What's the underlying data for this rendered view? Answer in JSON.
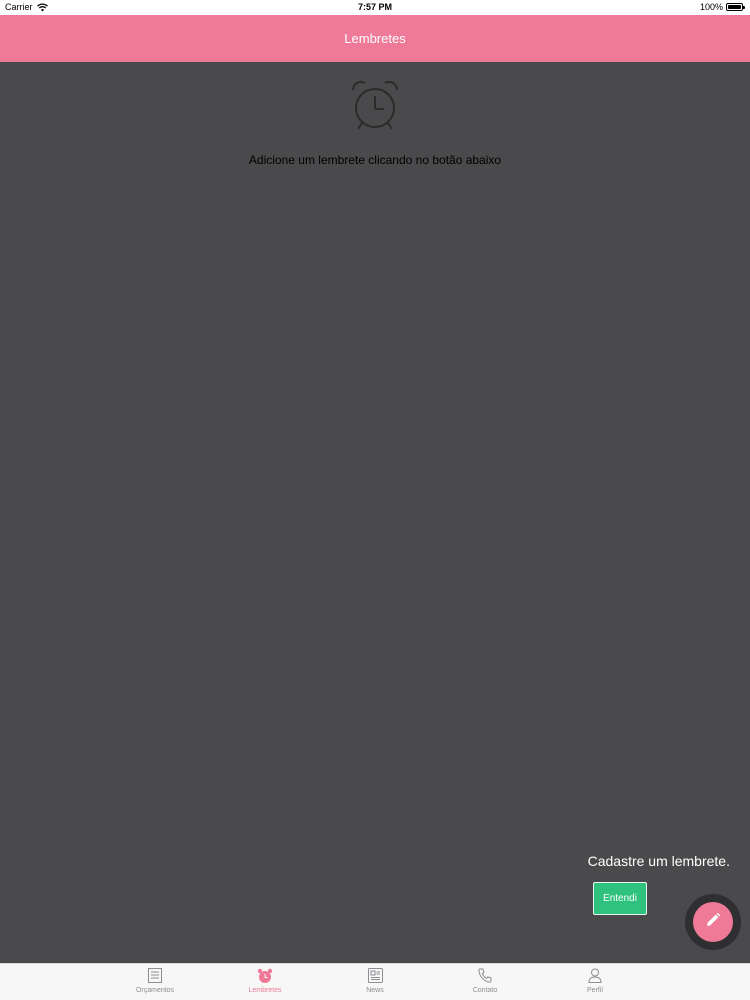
{
  "status_bar": {
    "carrier": "Carrier",
    "time": "7:57 PM",
    "battery_text": "100%",
    "battery_level": 1.0
  },
  "nav": {
    "title": "Lembretes"
  },
  "empty_state": {
    "icon": "alarm-clock-icon",
    "message": "Adicione um lembrete clicando no botão abaixo"
  },
  "tooltip": {
    "message": "Cadastre um lembrete.",
    "button_label": "Entendi"
  },
  "fab": {
    "icon": "pencil-icon"
  },
  "tabs": [
    {
      "label": "Orçamentos",
      "icon": "list-icon",
      "active": false
    },
    {
      "label": "Lembretes",
      "icon": "alarm-clock-icon",
      "active": true
    },
    {
      "label": "News",
      "icon": "newspaper-icon",
      "active": false
    },
    {
      "label": "Contato",
      "icon": "phone-icon",
      "active": false
    },
    {
      "label": "Perfil",
      "icon": "person-icon",
      "active": false
    }
  ],
  "colors": {
    "accent": "#ef7a98",
    "overlay": "#4a494b",
    "confirm": "#2ec27e",
    "tab_inactive": "#8e8e93"
  }
}
